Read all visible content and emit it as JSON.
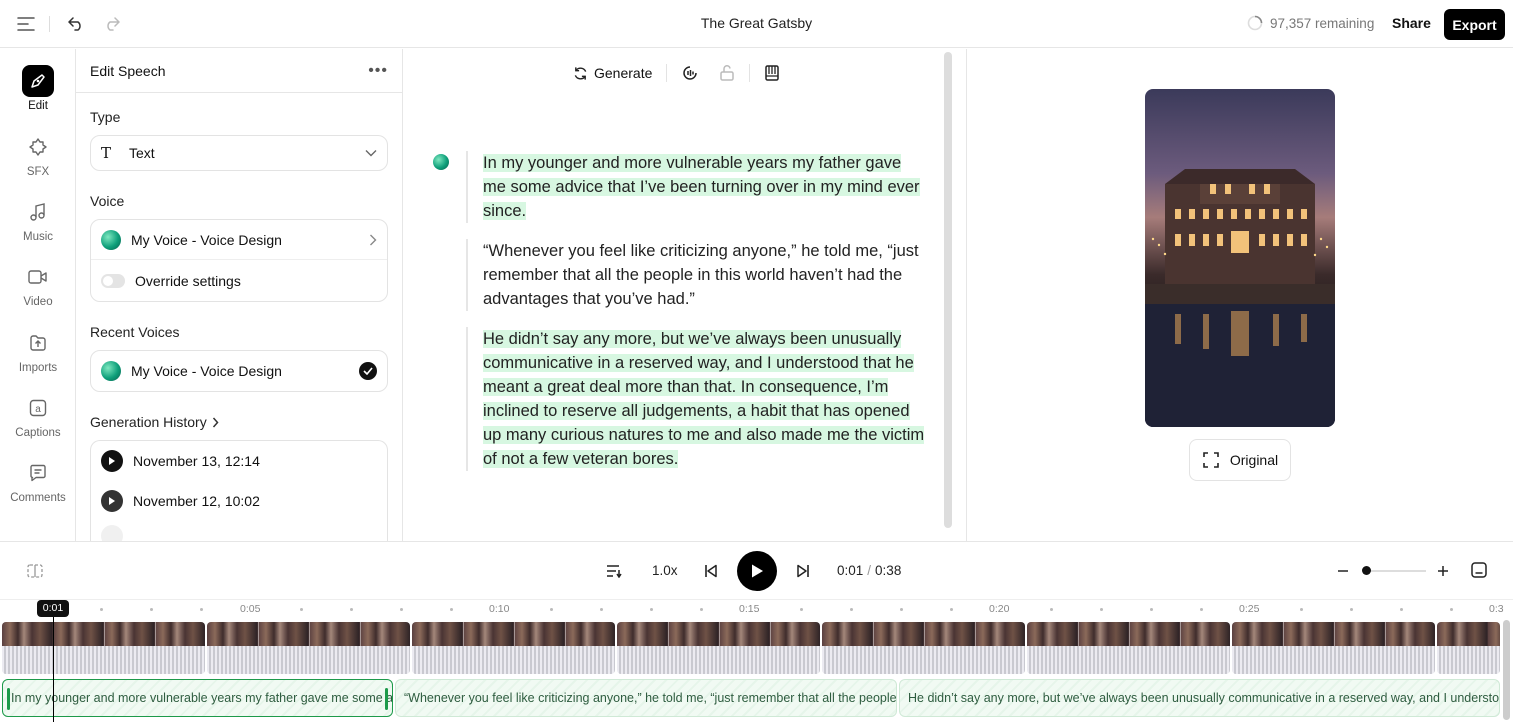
{
  "header": {
    "title": "The Great Gatsby",
    "remaining": "97,357 remaining",
    "share_label": "Share",
    "export_label": "Export"
  },
  "rail": {
    "items": [
      {
        "label": "Edit",
        "icon": "edit-icon",
        "active": true
      },
      {
        "label": "SFX",
        "icon": "sfx-icon"
      },
      {
        "label": "Music",
        "icon": "music-icon"
      },
      {
        "label": "Video",
        "icon": "video-icon"
      },
      {
        "label": "Imports",
        "icon": "upload-icon"
      },
      {
        "label": "Captions",
        "icon": "captions-icon"
      },
      {
        "label": "Comments",
        "icon": "comments-icon"
      }
    ]
  },
  "panel": {
    "title": "Edit Speech",
    "type_label": "Type",
    "type_value": "Text",
    "voice_label": "Voice",
    "voice_name": "My Voice - Voice Design",
    "override_label": "Override settings",
    "recent_label": "Recent Voices",
    "recent_voice": "My Voice - Voice Design",
    "history_label": "Generation History",
    "history": [
      {
        "label": "November 13, 12:14"
      },
      {
        "label": "November 12, 10:02"
      }
    ]
  },
  "editor": {
    "toolbar": {
      "generate_label": "Generate"
    },
    "paragraphs": [
      {
        "text": "In my younger and more vulnerable years my father gave me some advice that I’ve been turning over in my mind ever since.",
        "highlight": true
      },
      {
        "text": "“Whenever you feel like criticizing anyone,” he told me, “just remember that all the people in this world haven’t had the advantages that you’ve had.”",
        "highlight": false
      },
      {
        "text": "He didn’t say any more, but we’ve always been unusually communicative in a reserved way, and I understood that he meant a great deal more than that. In consequence, I’m inclined to reserve all judgements, a habit that has opened up many curious natures to me and also made me the victim of not a few veteran bores.",
        "highlight": true
      }
    ]
  },
  "preview": {
    "original_label": "Original"
  },
  "transport": {
    "speed": "1.0x",
    "current_time": "0:01",
    "total_time": "0:38"
  },
  "timeline": {
    "playhead_label": "0:01",
    "ticks": [
      "0:05",
      "0:10",
      "0:15",
      "0:20",
      "0:25",
      "0:3"
    ],
    "speech_clips": [
      "In my younger and more vulnerable years my father gave me some advice that I’ve been turning over in my mind ever since.",
      "“Whenever you feel like criticizing anyone,” he told me, “just remember that all the people in this world haven’t had the advantages that you’ve had.”",
      "He didn’t say any more, but we’ve always been unusually communicative in a reserved way, and I understood that he meant a great deal more than that."
    ]
  },
  "colors": {
    "accent_green": "#1d9a4a",
    "highlight": "#d7f7e1",
    "primary_button": "#000000"
  }
}
